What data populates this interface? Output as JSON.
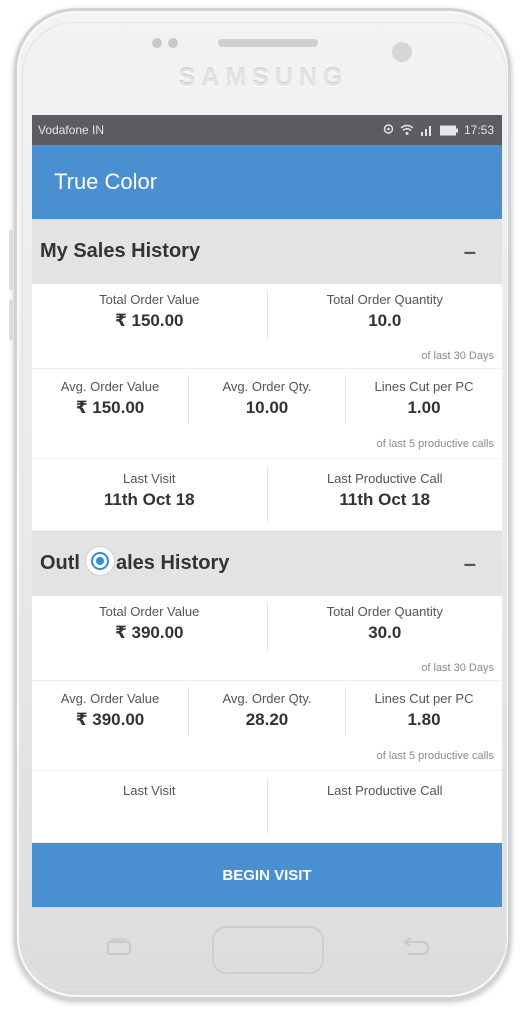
{
  "device": {
    "brand": "SAMSUNG"
  },
  "status_bar": {
    "carrier": "Vodafone IN",
    "time": "17:53"
  },
  "app_bar": {
    "title": "True Color"
  },
  "my_sales": {
    "header": "My Sales History",
    "toggle": "–",
    "total_order_value_label": "Total Order Value",
    "total_order_value": "₹ 150.00",
    "total_order_qty_label": "Total Order Quantity",
    "total_order_qty": "10.0",
    "period_note": "of last 30 Days",
    "avg_order_value_label": "Avg. Order Value",
    "avg_order_value": "₹ 150.00",
    "avg_order_qty_label": "Avg. Order Qty.",
    "avg_order_qty": "10.00",
    "lines_cut_label": "Lines Cut per PC",
    "lines_cut": "1.00",
    "calls_note": "of last 5 productive calls",
    "last_visit_label": "Last Visit",
    "last_visit": "11th Oct 18",
    "last_productive_label": "Last Productive Call",
    "last_productive": "11th Oct 18"
  },
  "outlet_sales": {
    "header_start": "Outl",
    "header_end": "ales History",
    "toggle": "–",
    "total_order_value_label": "Total Order Value",
    "total_order_value": "₹ 390.00",
    "total_order_qty_label": "Total Order Quantity",
    "total_order_qty": "30.0",
    "period_note": "of last 30 Days",
    "avg_order_value_label": "Avg. Order Value",
    "avg_order_value": "₹ 390.00",
    "avg_order_qty_label": "Avg. Order Qty.",
    "avg_order_qty": "28.20",
    "lines_cut_label": "Lines Cut per PC",
    "lines_cut": "1.80",
    "calls_note": "of last 5 productive calls",
    "last_visit_label": "Last Visit",
    "last_productive_label": "Last Productive Call"
  },
  "footer": {
    "begin_visit": "BEGIN VISIT"
  },
  "colors": {
    "primary": "#4a8fcf",
    "section_bg": "#e3e3e3",
    "status_bar": "#5b5d61"
  }
}
